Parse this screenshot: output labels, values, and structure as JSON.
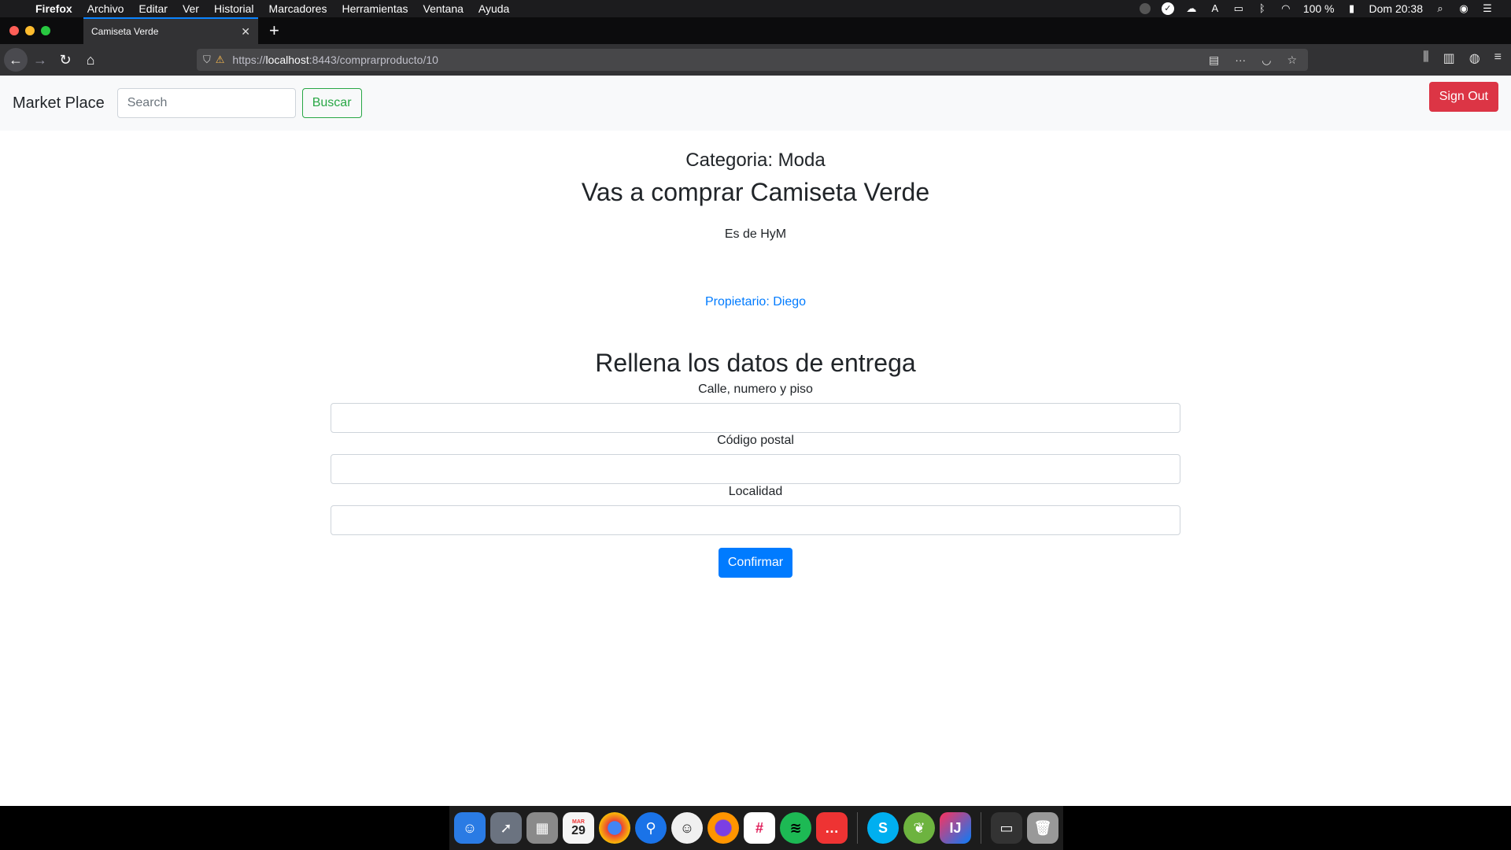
{
  "menubar": {
    "app_name": "Firefox",
    "menus": [
      "Archivo",
      "Editar",
      "Ver",
      "Historial",
      "Marcadores",
      "Herramientas",
      "Ventana",
      "Ayuda"
    ],
    "battery": "100 %",
    "clock": "Dom 20:38"
  },
  "browser": {
    "tab_title": "Camiseta Verde",
    "url_prefix": "https://",
    "url_host": "localhost",
    "url_path": ":8443/comprarproducto/10"
  },
  "site": {
    "brand": "Market Place",
    "search_placeholder": "Search",
    "search_button": "Buscar",
    "signout_button": "Sign Out"
  },
  "product": {
    "category": "Categoria: Moda",
    "title": "Vas a comprar Camiseta Verde",
    "description": "Es de HyM",
    "owner": "Propietario: Diego"
  },
  "form": {
    "title": "Rellena los datos de entrega",
    "street_label": "Calle, numero y piso",
    "postal_label": "Código postal",
    "city_label": "Localidad",
    "submit": "Confirmar"
  },
  "dock": {
    "calendar_day": "29",
    "calendar_month": "MAR"
  },
  "colors": {
    "primary": "#007bff",
    "success": "#28a745",
    "danger": "#dc3545"
  }
}
